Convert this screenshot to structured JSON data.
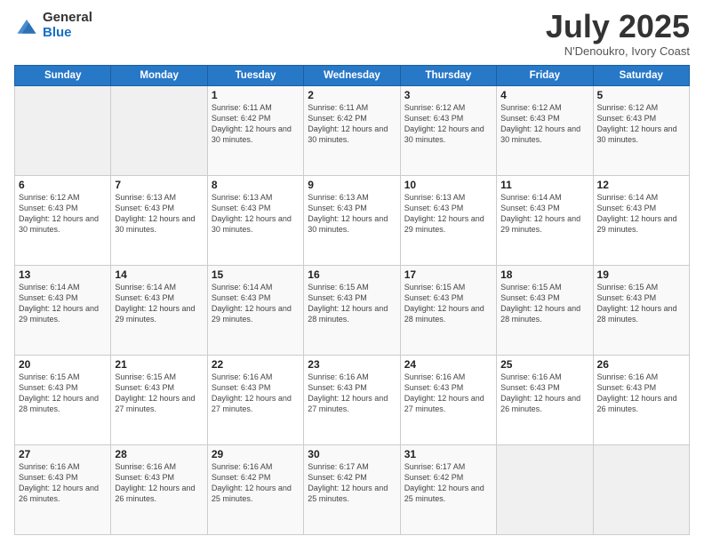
{
  "logo": {
    "general": "General",
    "blue": "Blue"
  },
  "header": {
    "month": "July 2025",
    "location": "N'Denoukro, Ivory Coast"
  },
  "weekdays": [
    "Sunday",
    "Monday",
    "Tuesday",
    "Wednesday",
    "Thursday",
    "Friday",
    "Saturday"
  ],
  "weeks": [
    [
      {
        "day": "",
        "sunrise": "",
        "sunset": "",
        "daylight": ""
      },
      {
        "day": "",
        "sunrise": "",
        "sunset": "",
        "daylight": ""
      },
      {
        "day": "1",
        "sunrise": "Sunrise: 6:11 AM",
        "sunset": "Sunset: 6:42 PM",
        "daylight": "Daylight: 12 hours and 30 minutes."
      },
      {
        "day": "2",
        "sunrise": "Sunrise: 6:11 AM",
        "sunset": "Sunset: 6:42 PM",
        "daylight": "Daylight: 12 hours and 30 minutes."
      },
      {
        "day": "3",
        "sunrise": "Sunrise: 6:12 AM",
        "sunset": "Sunset: 6:43 PM",
        "daylight": "Daylight: 12 hours and 30 minutes."
      },
      {
        "day": "4",
        "sunrise": "Sunrise: 6:12 AM",
        "sunset": "Sunset: 6:43 PM",
        "daylight": "Daylight: 12 hours and 30 minutes."
      },
      {
        "day": "5",
        "sunrise": "Sunrise: 6:12 AM",
        "sunset": "Sunset: 6:43 PM",
        "daylight": "Daylight: 12 hours and 30 minutes."
      }
    ],
    [
      {
        "day": "6",
        "sunrise": "Sunrise: 6:12 AM",
        "sunset": "Sunset: 6:43 PM",
        "daylight": "Daylight: 12 hours and 30 minutes."
      },
      {
        "day": "7",
        "sunrise": "Sunrise: 6:13 AM",
        "sunset": "Sunset: 6:43 PM",
        "daylight": "Daylight: 12 hours and 30 minutes."
      },
      {
        "day": "8",
        "sunrise": "Sunrise: 6:13 AM",
        "sunset": "Sunset: 6:43 PM",
        "daylight": "Daylight: 12 hours and 30 minutes."
      },
      {
        "day": "9",
        "sunrise": "Sunrise: 6:13 AM",
        "sunset": "Sunset: 6:43 PM",
        "daylight": "Daylight: 12 hours and 30 minutes."
      },
      {
        "day": "10",
        "sunrise": "Sunrise: 6:13 AM",
        "sunset": "Sunset: 6:43 PM",
        "daylight": "Daylight: 12 hours and 29 minutes."
      },
      {
        "day": "11",
        "sunrise": "Sunrise: 6:14 AM",
        "sunset": "Sunset: 6:43 PM",
        "daylight": "Daylight: 12 hours and 29 minutes."
      },
      {
        "day": "12",
        "sunrise": "Sunrise: 6:14 AM",
        "sunset": "Sunset: 6:43 PM",
        "daylight": "Daylight: 12 hours and 29 minutes."
      }
    ],
    [
      {
        "day": "13",
        "sunrise": "Sunrise: 6:14 AM",
        "sunset": "Sunset: 6:43 PM",
        "daylight": "Daylight: 12 hours and 29 minutes."
      },
      {
        "day": "14",
        "sunrise": "Sunrise: 6:14 AM",
        "sunset": "Sunset: 6:43 PM",
        "daylight": "Daylight: 12 hours and 29 minutes."
      },
      {
        "day": "15",
        "sunrise": "Sunrise: 6:14 AM",
        "sunset": "Sunset: 6:43 PM",
        "daylight": "Daylight: 12 hours and 29 minutes."
      },
      {
        "day": "16",
        "sunrise": "Sunrise: 6:15 AM",
        "sunset": "Sunset: 6:43 PM",
        "daylight": "Daylight: 12 hours and 28 minutes."
      },
      {
        "day": "17",
        "sunrise": "Sunrise: 6:15 AM",
        "sunset": "Sunset: 6:43 PM",
        "daylight": "Daylight: 12 hours and 28 minutes."
      },
      {
        "day": "18",
        "sunrise": "Sunrise: 6:15 AM",
        "sunset": "Sunset: 6:43 PM",
        "daylight": "Daylight: 12 hours and 28 minutes."
      },
      {
        "day": "19",
        "sunrise": "Sunrise: 6:15 AM",
        "sunset": "Sunset: 6:43 PM",
        "daylight": "Daylight: 12 hours and 28 minutes."
      }
    ],
    [
      {
        "day": "20",
        "sunrise": "Sunrise: 6:15 AM",
        "sunset": "Sunset: 6:43 PM",
        "daylight": "Daylight: 12 hours and 28 minutes."
      },
      {
        "day": "21",
        "sunrise": "Sunrise: 6:15 AM",
        "sunset": "Sunset: 6:43 PM",
        "daylight": "Daylight: 12 hours and 27 minutes."
      },
      {
        "day": "22",
        "sunrise": "Sunrise: 6:16 AM",
        "sunset": "Sunset: 6:43 PM",
        "daylight": "Daylight: 12 hours and 27 minutes."
      },
      {
        "day": "23",
        "sunrise": "Sunrise: 6:16 AM",
        "sunset": "Sunset: 6:43 PM",
        "daylight": "Daylight: 12 hours and 27 minutes."
      },
      {
        "day": "24",
        "sunrise": "Sunrise: 6:16 AM",
        "sunset": "Sunset: 6:43 PM",
        "daylight": "Daylight: 12 hours and 27 minutes."
      },
      {
        "day": "25",
        "sunrise": "Sunrise: 6:16 AM",
        "sunset": "Sunset: 6:43 PM",
        "daylight": "Daylight: 12 hours and 26 minutes."
      },
      {
        "day": "26",
        "sunrise": "Sunrise: 6:16 AM",
        "sunset": "Sunset: 6:43 PM",
        "daylight": "Daylight: 12 hours and 26 minutes."
      }
    ],
    [
      {
        "day": "27",
        "sunrise": "Sunrise: 6:16 AM",
        "sunset": "Sunset: 6:43 PM",
        "daylight": "Daylight: 12 hours and 26 minutes."
      },
      {
        "day": "28",
        "sunrise": "Sunrise: 6:16 AM",
        "sunset": "Sunset: 6:43 PM",
        "daylight": "Daylight: 12 hours and 26 minutes."
      },
      {
        "day": "29",
        "sunrise": "Sunrise: 6:16 AM",
        "sunset": "Sunset: 6:42 PM",
        "daylight": "Daylight: 12 hours and 25 minutes."
      },
      {
        "day": "30",
        "sunrise": "Sunrise: 6:17 AM",
        "sunset": "Sunset: 6:42 PM",
        "daylight": "Daylight: 12 hours and 25 minutes."
      },
      {
        "day": "31",
        "sunrise": "Sunrise: 6:17 AM",
        "sunset": "Sunset: 6:42 PM",
        "daylight": "Daylight: 12 hours and 25 minutes."
      },
      {
        "day": "",
        "sunrise": "",
        "sunset": "",
        "daylight": ""
      },
      {
        "day": "",
        "sunrise": "",
        "sunset": "",
        "daylight": ""
      }
    ]
  ]
}
